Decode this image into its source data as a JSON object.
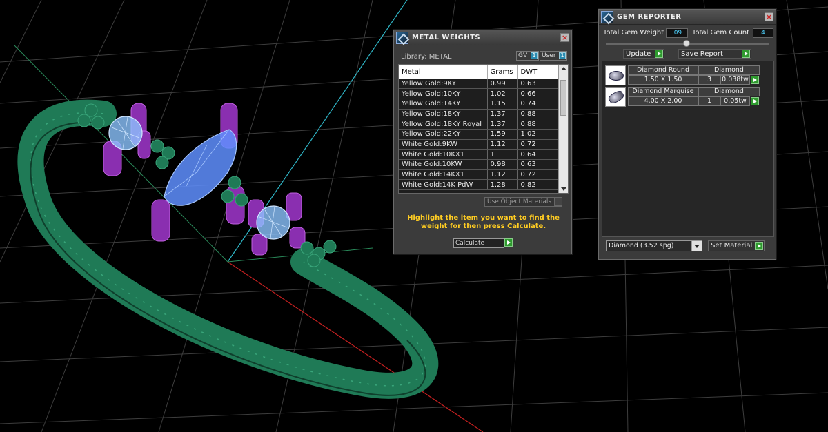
{
  "metal_weights": {
    "title": "METAL WEIGHTS",
    "library": "Library: METAL",
    "gv_label": "GV",
    "user_label": "User",
    "columns": [
      "Metal",
      "Grams",
      "DWT"
    ],
    "rows": [
      [
        "Yellow Gold:9KY",
        "0.99",
        "0.63"
      ],
      [
        "Yellow Gold:10KY",
        "1.02",
        "0.66"
      ],
      [
        "Yellow Gold:14KY",
        "1.15",
        "0.74"
      ],
      [
        "Yellow Gold:18KY",
        "1.37",
        "0.88"
      ],
      [
        "Yellow Gold:18KY Royal",
        "1.37",
        "0.88"
      ],
      [
        "Yellow Gold:22KY",
        "1.59",
        "1.02"
      ],
      [
        "White Gold:9KW",
        "1.12",
        "0.72"
      ],
      [
        "White Gold:10KX1",
        "1",
        "0.64"
      ],
      [
        "White Gold:10KW",
        "0.98",
        "0.63"
      ],
      [
        "White Gold:14KX1",
        "1.12",
        "0.72"
      ],
      [
        "White Gold:14K PdW",
        "1.28",
        "0.82"
      ]
    ],
    "use_object_materials": "Use Object Materials",
    "hint": "Highlight the item you want to find the weight for then press Calculate.",
    "calculate_label": "Calculate"
  },
  "gem_reporter": {
    "title": "GEM REPORTER",
    "total_weight_label": "Total Gem Weight",
    "total_weight_value": ".09",
    "total_count_label": "Total Gem Count",
    "total_count_value": "4",
    "update_label": "Update",
    "save_report_label": "Save Report",
    "gems": [
      {
        "shape": "Diamond Round",
        "material": "Diamond",
        "size": "1.50 X 1.50",
        "count": "3",
        "weight": "0.038tw"
      },
      {
        "shape": "Diamond Marquise",
        "material": "Diamond",
        "size": "4.00 X 2.00",
        "count": "1",
        "weight": "0.05tw"
      }
    ],
    "material_select": "Diamond    (3.52 spg)",
    "set_material_label": "Set Material"
  },
  "colors": {
    "viewport_bg": "#000000",
    "grid": "#3a3a3a",
    "ring_band": "#1f7a56",
    "prongs": "#8a2fb0",
    "gem": "#6aa8ff",
    "hint": "#ffcc22"
  }
}
